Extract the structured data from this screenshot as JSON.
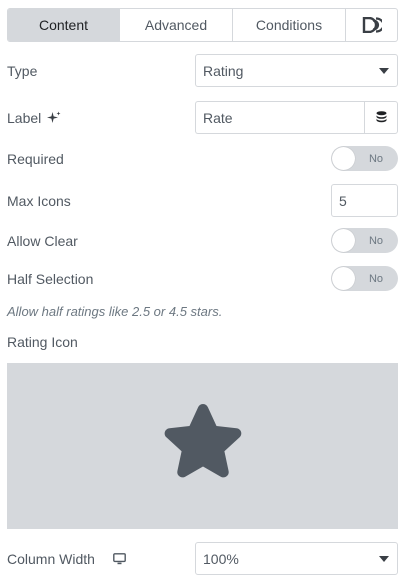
{
  "tabs": {
    "content": "Content",
    "advanced": "Advanced",
    "conditions": "Conditions",
    "dynamic_icon": "dynamic-d-icon"
  },
  "fields": {
    "type": {
      "label": "Type",
      "value": "Rating"
    },
    "label": {
      "label": "Label",
      "value": "Rate",
      "ai_icon": "sparkle-icon",
      "dynamic_icon": "database-icon"
    },
    "required": {
      "label": "Required",
      "toggle": "No"
    },
    "max_icons": {
      "label": "Max Icons",
      "value": "5"
    },
    "allow_clear": {
      "label": "Allow Clear",
      "toggle": "No"
    },
    "half_selection": {
      "label": "Half Selection",
      "toggle": "No",
      "hint": "Allow half ratings like 2.5 or 4.5 stars."
    },
    "rating_icon": {
      "label": "Rating Icon",
      "icon": "star-icon"
    },
    "column_width": {
      "label": "Column Width",
      "device_icon": "desktop-icon",
      "value": "100%"
    }
  },
  "colors": {
    "accent_active_tab": "#d5d8dc",
    "text": "#515962",
    "star": "#515962"
  }
}
